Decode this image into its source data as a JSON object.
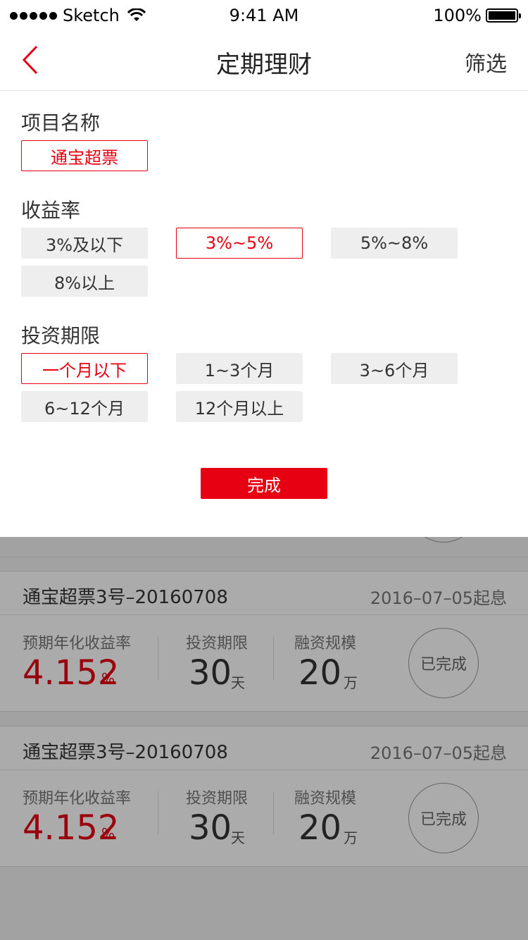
{
  "status": {
    "carrier": "Sketch",
    "time": "9:41 AM",
    "battery": "100%"
  },
  "nav": {
    "title": "定期理财",
    "filter": "筛选"
  },
  "filters": {
    "project": {
      "title": "项目名称",
      "options": [
        "通宝超票"
      ],
      "selected": "通宝超票"
    },
    "yield": {
      "title": "收益率",
      "options": [
        "3%及以下",
        "3%~5%",
        "5%~8%",
        "8%以上"
      ],
      "selected": "3%~5%"
    },
    "term": {
      "title": "投资期限",
      "options": [
        "一个月以下",
        "1~3个月",
        "3~6个月",
        "6~12个月",
        "12个月以上"
      ],
      "selected": "一个月以下"
    },
    "done": "完成"
  },
  "products": [
    {
      "name": "通宝超票3号–20160708",
      "date": "2016–07–05起息",
      "yield_label": "预期年化收益率",
      "yield": "4.152",
      "yield_unit": "%",
      "term_label": "投资期限",
      "term": "30",
      "term_unit": "天",
      "scale_label": "融资规模",
      "scale": "20",
      "scale_unit": "万",
      "status": "已完成"
    },
    {
      "name": "通宝超票3号–20160708",
      "date": "2016–07–05起息",
      "yield_label": "预期年化收益率",
      "yield": "4.152",
      "yield_unit": "%",
      "term_label": "投资期限",
      "term": "30",
      "term_unit": "天",
      "scale_label": "融资规模",
      "scale": "20",
      "scale_unit": "万",
      "status": "已完成"
    }
  ],
  "colors": {
    "accent": "#e60012",
    "chip_bg": "#eeeeee",
    "overlay": "rgba(0,0,0,0.33)"
  }
}
